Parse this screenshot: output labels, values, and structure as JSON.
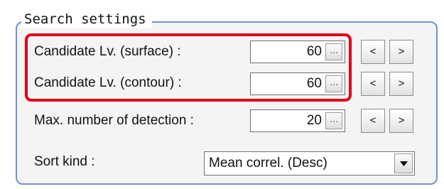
{
  "group": {
    "title": "Search settings"
  },
  "rows": [
    {
      "label": "Candidate Lv. (surface) :",
      "value": "60",
      "more": "...",
      "dec": "<",
      "inc": ">"
    },
    {
      "label": "Candidate Lv. (contour) :",
      "value": "60",
      "more": "...",
      "dec": "<",
      "inc": ">"
    },
    {
      "label": "Max. number of detection :",
      "value": "20",
      "more": "...",
      "dec": "<",
      "inc": ">"
    }
  ],
  "sort": {
    "label": "Sort kind :",
    "value": "Mean correl. (Desc)"
  },
  "icons": {
    "dropdown": "chevron-down-icon"
  },
  "colors": {
    "group_border": "#6d8fd6",
    "highlight": "#e2001a"
  }
}
